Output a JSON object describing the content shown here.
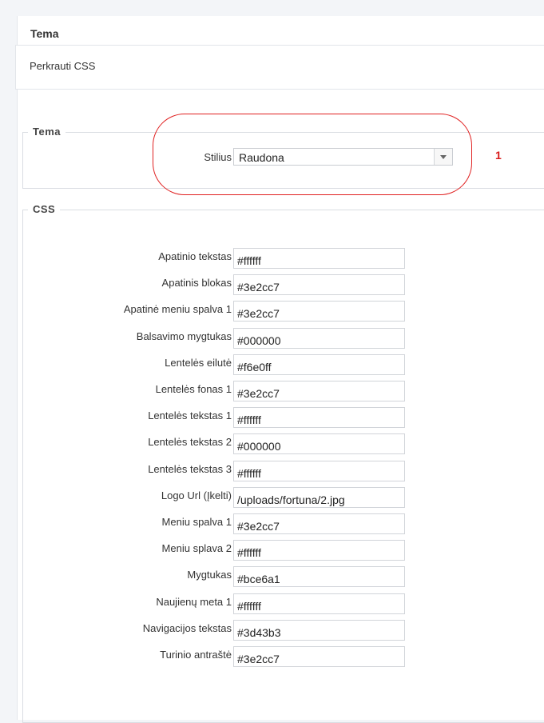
{
  "panel": {
    "title": "Tema",
    "reload_label": "Perkrauti CSS"
  },
  "theme_section": {
    "legend": "Tema",
    "style_label": "Stilius",
    "style_value": "Raudona",
    "annotation_number": "1",
    "annotation_color": "#e02020"
  },
  "css_section": {
    "legend": "CSS",
    "fields": [
      {
        "label": "Apatinio tekstas",
        "value": "#ffffff"
      },
      {
        "label": "Apatinis blokas",
        "value": "#3e2cc7"
      },
      {
        "label": "Apatinė meniu spalva 1",
        "value": "#3e2cc7"
      },
      {
        "label": "Balsavimo mygtukas",
        "value": "#000000"
      },
      {
        "label": "Lentelės eilutė",
        "value": "#f6e0ff"
      },
      {
        "label": "Lentelės fonas 1",
        "value": "#3e2cc7"
      },
      {
        "label": "Lentelės tekstas 1",
        "value": "#ffffff"
      },
      {
        "label": "Lentelės tekstas 2",
        "value": "#000000"
      },
      {
        "label": "Lentelės tekstas 3",
        "value": "#ffffff"
      },
      {
        "label": "Logo Url (Įkelti)",
        "value": "/uploads/fortuna/2.jpg"
      },
      {
        "label": "Meniu spalva 1",
        "value": "#3e2cc7"
      },
      {
        "label": "Meniu splava 2",
        "value": "#ffffff"
      },
      {
        "label": "Mygtukas",
        "value": "#bce6a1"
      },
      {
        "label": "Naujienų meta 1",
        "value": "#ffffff"
      },
      {
        "label": "Navigacijos tekstas",
        "value": "#3d43b3"
      },
      {
        "label": "Turinio antraštė",
        "value": "#3e2cc7"
      }
    ]
  }
}
